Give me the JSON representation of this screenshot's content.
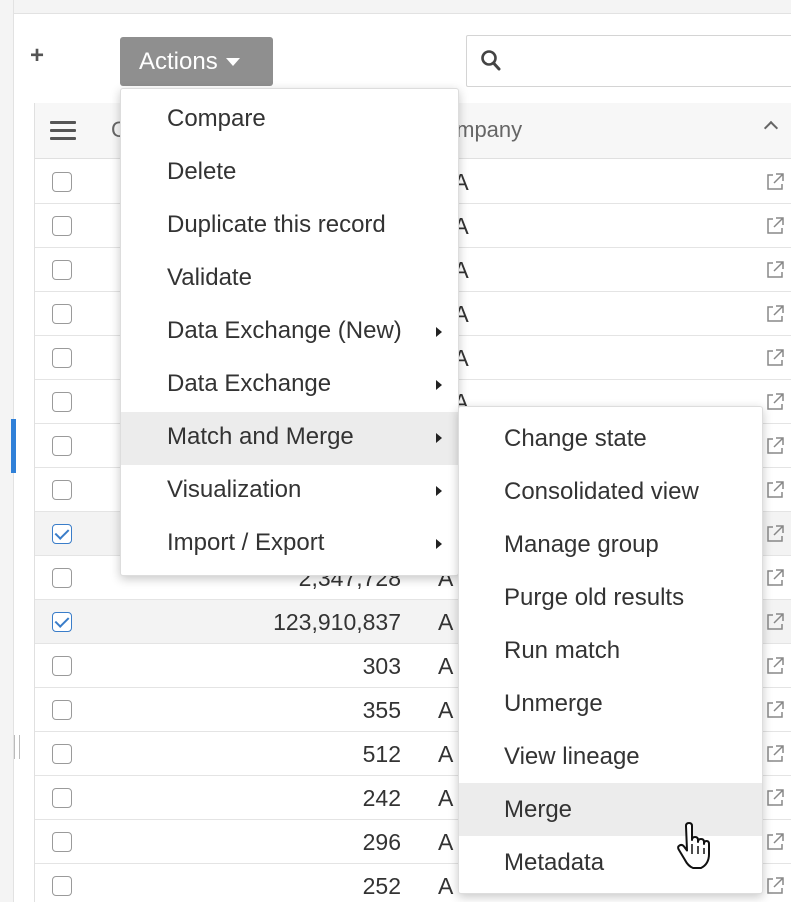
{
  "toolbar": {
    "add_label": "+",
    "actions_label": "Actions",
    "search_value": "",
    "search_placeholder": ""
  },
  "grid": {
    "partial_column_header": "C",
    "company_column_header": "Company",
    "rows": [
      {
        "checked": false,
        "value": "",
        "company": "AA"
      },
      {
        "checked": false,
        "value": "",
        "company": "AA"
      },
      {
        "checked": false,
        "value": "",
        "company": "AA"
      },
      {
        "checked": false,
        "value": "",
        "company": "AA"
      },
      {
        "checked": false,
        "value": "",
        "company": "AA"
      },
      {
        "checked": false,
        "value": "",
        "company": "AA"
      },
      {
        "checked": false,
        "value": "",
        "company": ""
      },
      {
        "checked": false,
        "value": "",
        "company": ""
      },
      {
        "checked": true,
        "value": "",
        "company": ""
      },
      {
        "checked": false,
        "value": "2,347,728",
        "company": "A"
      },
      {
        "checked": true,
        "value": "123,910,837",
        "company": "A"
      },
      {
        "checked": false,
        "value": "303",
        "company": "A"
      },
      {
        "checked": false,
        "value": "355",
        "company": "A"
      },
      {
        "checked": false,
        "value": "512",
        "company": "A"
      },
      {
        "checked": false,
        "value": "242",
        "company": "A"
      },
      {
        "checked": false,
        "value": "296",
        "company": "A"
      },
      {
        "checked": false,
        "value": "252",
        "company": "A"
      }
    ]
  },
  "actions_menu": {
    "items": [
      {
        "label": "Compare",
        "has_submenu": false
      },
      {
        "label": "Delete",
        "has_submenu": false
      },
      {
        "label": "Duplicate this record",
        "has_submenu": false
      },
      {
        "label": "Validate",
        "has_submenu": false
      },
      {
        "label": "Data Exchange (New)",
        "has_submenu": true
      },
      {
        "label": "Data Exchange",
        "has_submenu": true
      },
      {
        "label": "Match and Merge",
        "has_submenu": true,
        "highlighted": true
      },
      {
        "label": "Visualization",
        "has_submenu": true
      },
      {
        "label": "Import / Export",
        "has_submenu": true
      }
    ]
  },
  "match_merge_submenu": {
    "items": [
      {
        "label": "Change state"
      },
      {
        "label": "Consolidated view"
      },
      {
        "label": "Manage group"
      },
      {
        "label": "Purge old results"
      },
      {
        "label": "Run match"
      },
      {
        "label": "Unmerge"
      },
      {
        "label": "View lineage"
      },
      {
        "label": "Merge",
        "highlighted": true
      },
      {
        "label": "Metadata"
      }
    ]
  },
  "colors": {
    "actions_button": "#8f8f8f",
    "checkbox_checked": "#3a7dc9",
    "accent_bar": "#2f80d8",
    "menu_hover": "#ececec"
  }
}
